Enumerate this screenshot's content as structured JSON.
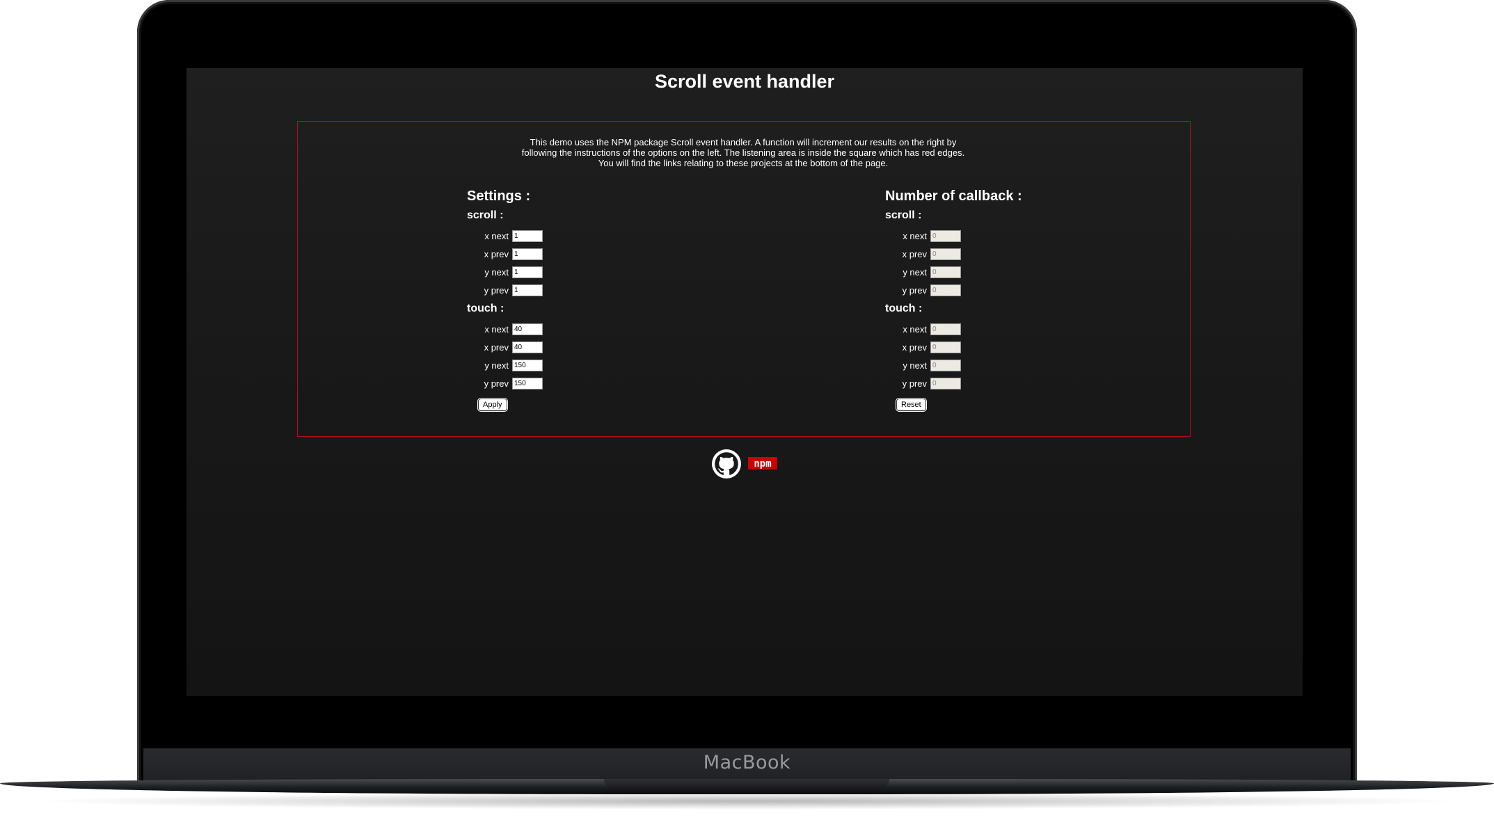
{
  "device": {
    "brand": "MacBook"
  },
  "page": {
    "title": "Scroll event handler",
    "intro": "This demo uses the NPM package Scroll event handler. A function will increment our results on the right by following the instructions of the options on the left. The listening area is inside the square which has red edges. You will find the links relating to these projects at the bottom of the page."
  },
  "settings": {
    "heading": "Settings :",
    "scroll": {
      "heading": "scroll :",
      "fields": [
        {
          "label": "x next",
          "value": "1"
        },
        {
          "label": "x prev",
          "value": "1"
        },
        {
          "label": "y next",
          "value": "1"
        },
        {
          "label": "y prev",
          "value": "1"
        }
      ]
    },
    "touch": {
      "heading": "touch :",
      "fields": [
        {
          "label": "x next",
          "value": "40"
        },
        {
          "label": "x prev",
          "value": "40"
        },
        {
          "label": "y next",
          "value": "150"
        },
        {
          "label": "y prev",
          "value": "150"
        }
      ]
    },
    "apply_label": "Apply"
  },
  "callbacks": {
    "heading": "Number of callback :",
    "scroll": {
      "heading": "scroll :",
      "fields": [
        {
          "label": "x next",
          "value": "0"
        },
        {
          "label": "x prev",
          "value": "0"
        },
        {
          "label": "y next",
          "value": "0"
        },
        {
          "label": "y prev",
          "value": "0"
        }
      ]
    },
    "touch": {
      "heading": "touch :",
      "fields": [
        {
          "label": "x next",
          "value": "0"
        },
        {
          "label": "x prev",
          "value": "0"
        },
        {
          "label": "y next",
          "value": "0"
        },
        {
          "label": "y prev",
          "value": "0"
        }
      ]
    },
    "reset_label": "Reset"
  },
  "footer": {
    "github_icon": "github-icon",
    "npm_logo": "npm",
    "npm_color": "#cb0000"
  },
  "colors": {
    "accent_border": "#b0101a",
    "page_background": "#1c1c1c"
  }
}
